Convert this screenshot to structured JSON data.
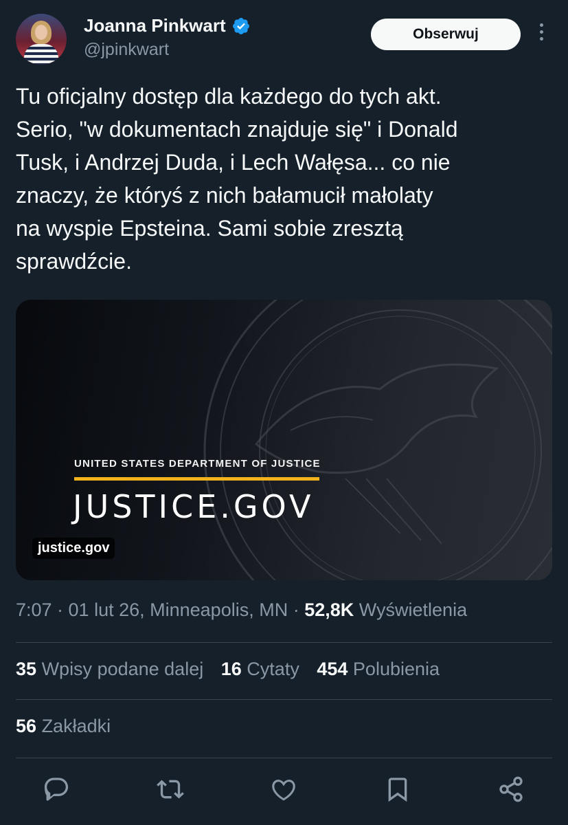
{
  "author": {
    "name": "Joanna Pinkwart",
    "handle": "@jpinkwart",
    "verified_icon": "verified-badge-icon",
    "follow_label": "Obserwuj"
  },
  "tweet": {
    "text": "Tu oficjalny dostęp dla każdego do tych akt.\nSerio, \"w dokumentach znajduje się\" i Donald\nTusk, i Andrzej Duda, i Lech Wałęsa... co nie\nznaczy, że któryś z nich bałamucił małolaty\nna wyspie Epsteina. Sami sobie zresztą\nsprawdźcie."
  },
  "card": {
    "kicker": "UNITED STATES DEPARTMENT OF JUSTICE",
    "title": "JUSTICE.GOV",
    "domain": "justice.gov",
    "accent_color": "#f2b21b"
  },
  "meta": {
    "time_date_place": "7:07 · 01 lut 26, Minneapolis, MN · ",
    "views_count": "52,8K",
    "views_label": "Wyświetlenia"
  },
  "stats": {
    "reposts_count": "35",
    "reposts_label": "Wpisy podane dalej",
    "quotes_count": "16",
    "quotes_label": "Cytaty",
    "likes_count": "454",
    "likes_label": "Polubienia"
  },
  "bookmarks": {
    "count": "56",
    "label": "Zakładki"
  },
  "actions": [
    "reply-icon",
    "repost-icon",
    "like-icon",
    "bookmark-icon",
    "share-icon"
  ],
  "colors": {
    "background": "#15202b",
    "text": "#f7f9f9",
    "secondary_text": "#8b98a5",
    "verified_blue": "#1d9bf0",
    "divider": "#38444d"
  }
}
